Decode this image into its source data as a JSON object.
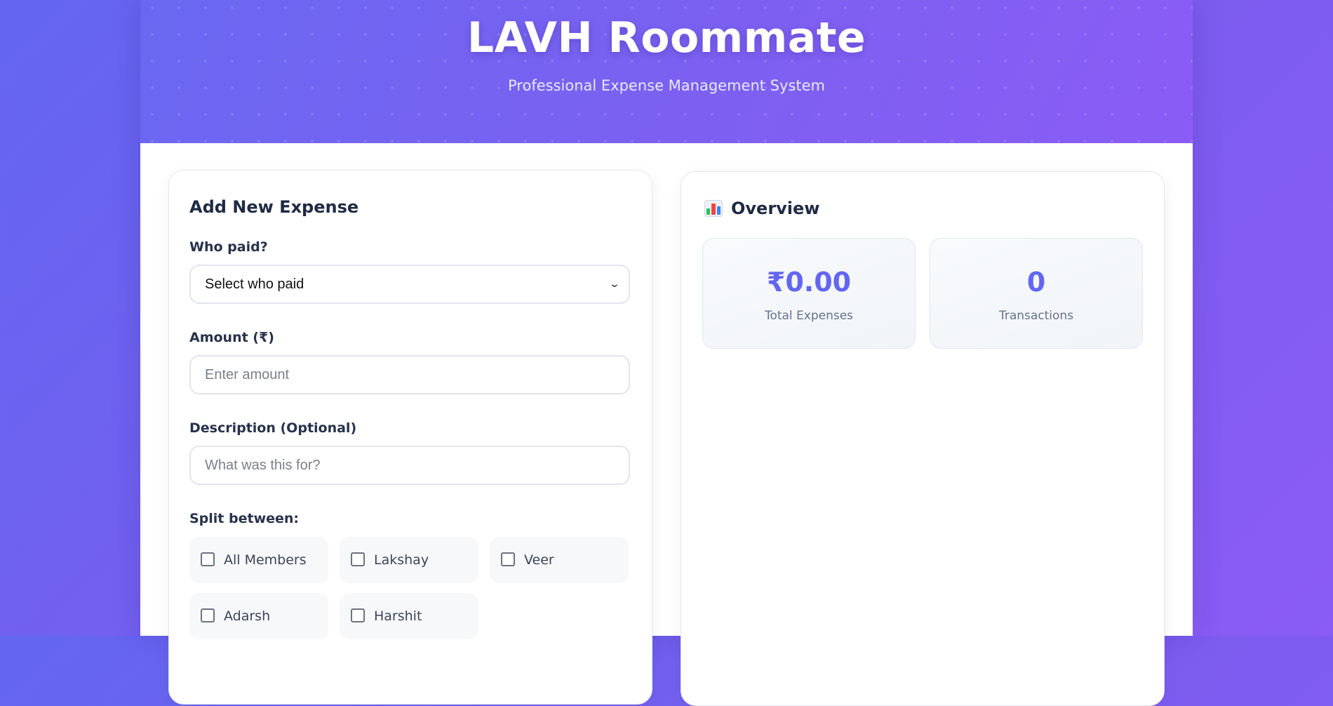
{
  "header": {
    "title": "LAVH Roommate",
    "subtitle": "Professional Expense Management System"
  },
  "expense_form": {
    "title": "Add New Expense",
    "who_paid": {
      "label": "Who paid?",
      "selected": "Select who paid"
    },
    "amount": {
      "label": "Amount (₹)",
      "placeholder": "Enter amount",
      "value": ""
    },
    "description": {
      "label": "Description (Optional)",
      "placeholder": "What was this for?",
      "value": ""
    },
    "split": {
      "label": "Split between:",
      "options": [
        {
          "label": "All Members",
          "checked": false
        },
        {
          "label": "Lakshay",
          "checked": false
        },
        {
          "label": "Veer",
          "checked": false
        },
        {
          "label": "Adarsh",
          "checked": false
        },
        {
          "label": "Harshit",
          "checked": false
        }
      ]
    }
  },
  "overview": {
    "title": "Overview",
    "icon": "bar-chart-icon",
    "stats": [
      {
        "value": "₹0.00",
        "label": "Total Expenses"
      },
      {
        "value": "0",
        "label": "Transactions"
      }
    ]
  },
  "colors": {
    "accent": "#6366f1",
    "background_start": "#6366f1",
    "background_end": "#8b5cf6"
  }
}
